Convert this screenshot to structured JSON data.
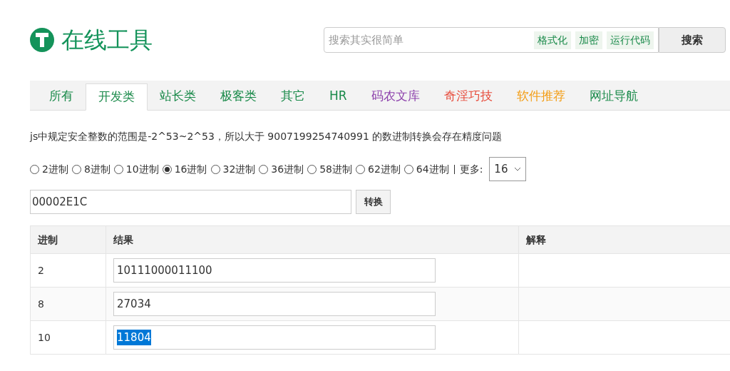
{
  "logo": {
    "title": "在线工具"
  },
  "search": {
    "placeholder": "搜索其实很简单",
    "quick_links": [
      "格式化",
      "加密",
      "运行代码"
    ],
    "button": "搜索"
  },
  "tabs": [
    {
      "label": "所有",
      "selected": false,
      "color": "#1a8a4a"
    },
    {
      "label": "开发类",
      "selected": true,
      "color": "#1a8a4a"
    },
    {
      "label": "站长类",
      "selected": false,
      "color": "#1a8a4a"
    },
    {
      "label": "极客类",
      "selected": false,
      "color": "#1a8a4a"
    },
    {
      "label": "其它",
      "selected": false,
      "color": "#1a8a4a"
    },
    {
      "label": "HR",
      "selected": false,
      "color": "#1a8a4a"
    },
    {
      "label": "码农文库",
      "selected": false,
      "color": "#8e44ad"
    },
    {
      "label": "奇淫巧技",
      "selected": false,
      "color": "#e74c3c"
    },
    {
      "label": "软件推荐",
      "selected": false,
      "color": "#f39c12"
    },
    {
      "label": "网址导航",
      "selected": false,
      "color": "#1a8a4a"
    }
  ],
  "notice": "js中规定安全整数的范围是-2^53~2^53，所以大于 9007199254740991 的数进制转换会存在精度问题",
  "bases": [
    {
      "label": "2进制",
      "selected": false
    },
    {
      "label": "8进制",
      "selected": false
    },
    {
      "label": "10进制",
      "selected": false
    },
    {
      "label": "16进制",
      "selected": true
    },
    {
      "label": "32进制",
      "selected": false
    },
    {
      "label": "36进制",
      "selected": false
    },
    {
      "label": "58进制",
      "selected": false
    },
    {
      "label": "62进制",
      "selected": false
    },
    {
      "label": "64进制",
      "selected": false
    }
  ],
  "more": {
    "label": "更多:",
    "value": "16"
  },
  "input": {
    "value": "00002E1C",
    "button": "转换"
  },
  "table": {
    "columns": [
      "进制",
      "结果",
      "解释"
    ],
    "rows": [
      {
        "base": "2",
        "result": "10111000011100",
        "selected": false
      },
      {
        "base": "8",
        "result": "27034",
        "selected": false
      },
      {
        "base": "10",
        "result": "11804",
        "selected": true
      }
    ]
  }
}
